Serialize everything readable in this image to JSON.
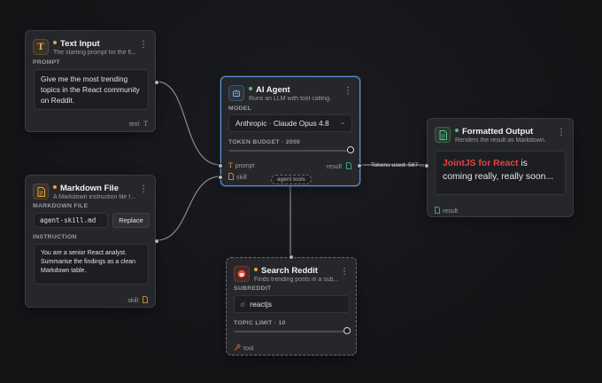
{
  "nodes": {
    "text_input": {
      "title": "Text Input",
      "subtitle": "The starting prompt for the fl...",
      "prompt_label": "PROMPT",
      "prompt_value": "Give me the most trending topics in the React community on Reddit.",
      "footer": "text",
      "dot_color": "#e8a33d"
    },
    "markdown_file": {
      "title": "Markdown File",
      "subtitle": "A Markdown instruction file f...",
      "file_label": "MARKDOWN FILE",
      "file_value": "agent-skill.md",
      "replace_label": "Replace",
      "instruction_label": "INSTRUCTION",
      "instruction_value": "You are a senior React analyst. Summarise the findings as a clean Markdown table.",
      "footer": "skill",
      "dot_color": "#e8a33d"
    },
    "ai_agent": {
      "title": "AI Agent",
      "subtitle": "Runs an LLM with tool calling.",
      "model_label": "MODEL",
      "model_value": "Anthropic · Claude Opus 4.8",
      "budget_label": "TOKEN BUDGET · 2000",
      "budget_fraction": 1.0,
      "port_prompt": "prompt",
      "port_skill": "skill",
      "port_result": "result",
      "tools_label": "agent tools",
      "dot_color": "#4cc38a"
    },
    "formatted_output": {
      "title": "Formatted Output",
      "subtitle": "Renders the result as Markdown.",
      "highlight": "JointJS for React",
      "body": " is coming really, really soon...",
      "footer": "result",
      "dot_color": "#4cc38a",
      "highlight_color": "#e0463e"
    },
    "search_reddit": {
      "title": "Search Reddit",
      "subtitle": "Finds trending posts in a sub...",
      "subreddit_label": "SUBREDDIT",
      "subreddit_prefix": "r/",
      "subreddit_value": "reactjs",
      "limit_label": "TOPIC LIMIT · 10",
      "limit_fraction": 1.0,
      "footer": "tool",
      "dot_color": "#e8a33d"
    }
  },
  "edges": {
    "tokens_label": "Tokens used: 567 ..."
  },
  "icons": {
    "text_input": "text-t-icon",
    "markdown_file": "markdown-file-icon",
    "ai_agent": "robot-icon",
    "formatted_output": "document-icon",
    "search_reddit": "reddit-icon"
  }
}
